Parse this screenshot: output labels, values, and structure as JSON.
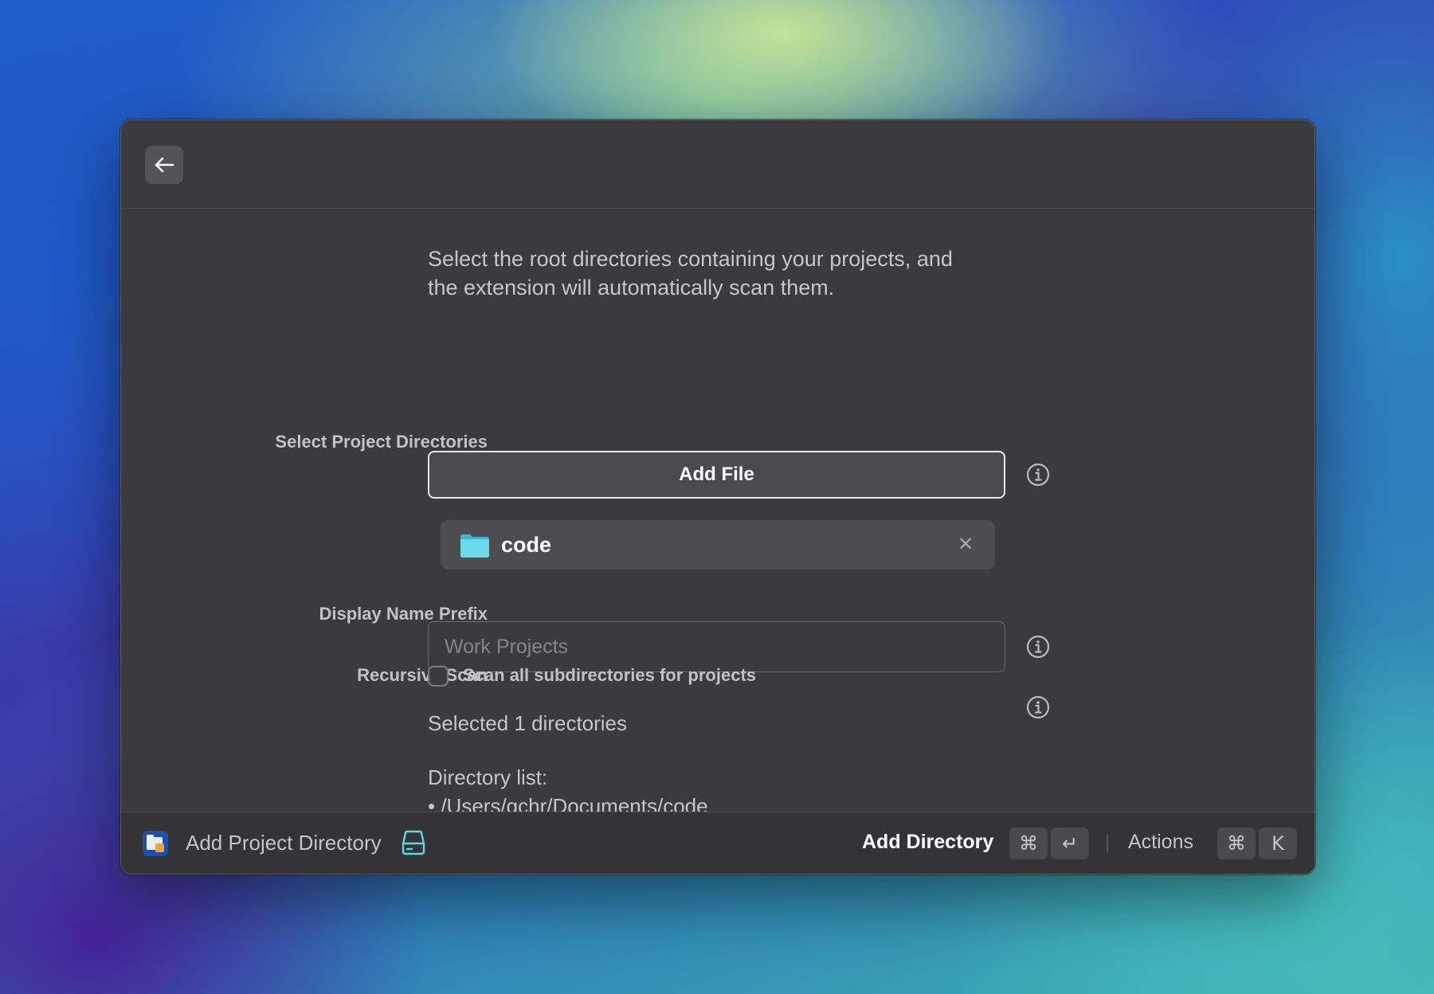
{
  "header": {
    "back_icon": "arrow-left-icon"
  },
  "intro": {
    "line1": "Select the root directories containing your projects, and",
    "line2": "the extension will automatically scan them."
  },
  "form": {
    "directories": {
      "label": "Select Project Directories",
      "button_label": "Add File",
      "selected": [
        {
          "name": "code",
          "icon": "folder-icon"
        }
      ]
    },
    "prefix": {
      "label": "Display Name Prefix",
      "value": "",
      "placeholder": "Work Projects"
    },
    "recursive": {
      "label": "Recursive Scan",
      "checkbox_label": "Scan all subdirectories for projects",
      "checked": false
    },
    "info_icon": "info-circle-icon"
  },
  "summary": {
    "selected_text": "Selected 1 directories",
    "list_heading": "Directory list:",
    "items": [
      "• /Users/gchr/Documents/code"
    ]
  },
  "footer": {
    "title": "Add Project Directory",
    "primary_action": "Add Directory",
    "primary_keys": [
      "⌘",
      "↵"
    ],
    "secondary_action": "Actions",
    "secondary_keys": [
      "⌘",
      "K"
    ]
  },
  "colors": {
    "window_bg": "#3b3b3d",
    "footer_bg": "#343436",
    "accent_folder": "#5fd4e6"
  }
}
